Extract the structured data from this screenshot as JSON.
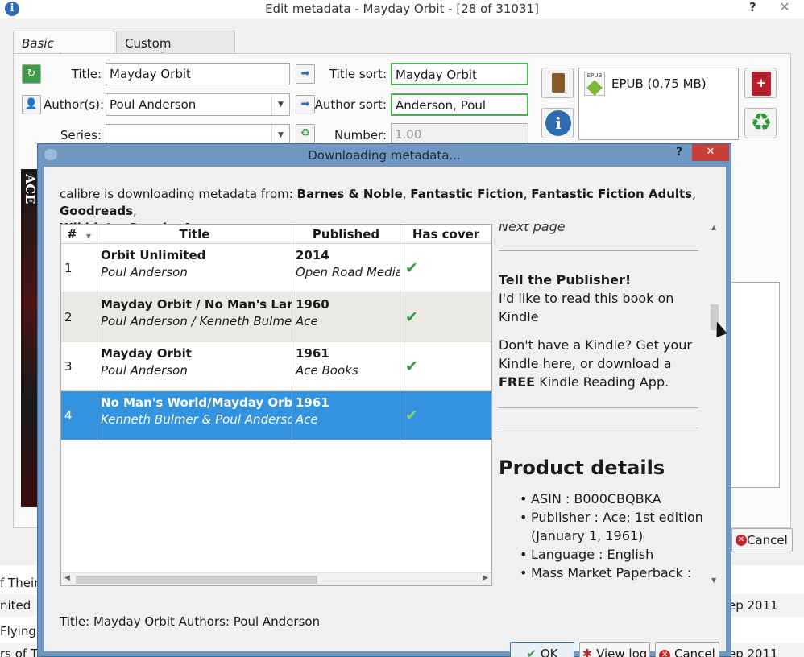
{
  "edit_window": {
    "title": "Edit metadata - Mayday Orbit -  [28 of 31031]",
    "help": "?",
    "close": "✕",
    "tabs": [
      {
        "label": "Basic metadata"
      },
      {
        "label": "Custom metadata"
      }
    ],
    "fields": {
      "title_label": "Title:",
      "title_value": "Mayday Orbit",
      "author_label": "Author(s):",
      "author_value": "Poul Anderson",
      "series_label": "Series:",
      "series_value": "",
      "title_sort_label": "Title sort:",
      "title_sort_value": "Mayday Orbit",
      "author_sort_label": "Author sort:",
      "author_sort_value": "Anderson, Poul",
      "number_label": "Number:",
      "number_value": "1.00"
    },
    "format": {
      "label": "EPUB (0.75 MB)",
      "badge": "EPUB"
    },
    "cover_text": "ACE",
    "cancel_label": "Cancel"
  },
  "background_list": [
    {
      "left": "f Their",
      "right": ""
    },
    {
      "left": "nited",
      "right": "ep 2011"
    },
    {
      "left": "Flying",
      "right": ""
    },
    {
      "left": "rs of T",
      "right": "ep 2011"
    }
  ],
  "dialog": {
    "title": "Downloading metadata...",
    "help": "?",
    "close": "✕",
    "info_prefix": "calibre is downloading metadata from: ",
    "sources": [
      "Barnes & Noble",
      "Fantastic Fiction",
      "Fantastic Fiction Adults",
      "Goodreads",
      "Wikidata",
      "Google",
      "Amazon.com"
    ],
    "columns": [
      "#",
      "Title",
      "Published",
      "Has cover"
    ],
    "results": [
      {
        "num": "1",
        "title": "Orbit Unlimited",
        "authors": "Poul Anderson",
        "year": "2014",
        "publisher": "Open Road Media",
        "has_cover": true
      },
      {
        "num": "2",
        "title": "Mayday Orbit / No Man's Land",
        "authors": "Poul Anderson / Kenneth Bulmer",
        "year": "1960",
        "publisher": "Ace",
        "has_cover": true
      },
      {
        "num": "3",
        "title": "Mayday Orbit",
        "authors": "Poul Anderson",
        "year": "1961",
        "publisher": "Ace Books",
        "has_cover": true
      },
      {
        "num": "4",
        "title": "No Man's World/Mayday Orbit",
        "authors": "Kenneth Bulmer & Poul Anderson",
        "year": "1961",
        "publisher": "Ace",
        "has_cover": true
      }
    ],
    "selected_index": 3,
    "detail": {
      "next_page": "Next page",
      "publisher_heading": "Tell the Publisher!",
      "publisher_text": "I'd like to read this book on Kindle",
      "kindle_text_1": "Don't have a Kindle? Get your Kindle here, or download a",
      "kindle_free": "FREE",
      "kindle_text_2": " Kindle Reading App.",
      "product_heading": "Product details",
      "bullets": [
        "ASIN  :  B000CBQBKA",
        "Publisher  :  Ace; 1st edition (January 1, 1961)",
        "Language  :  English",
        "Mass Market Paperback  :"
      ]
    },
    "footer_text": "Title: Mayday Orbit Authors: Poul Anderson",
    "buttons": {
      "ok": "OK",
      "view_log": "View log",
      "cancel": "Cancel"
    }
  }
}
